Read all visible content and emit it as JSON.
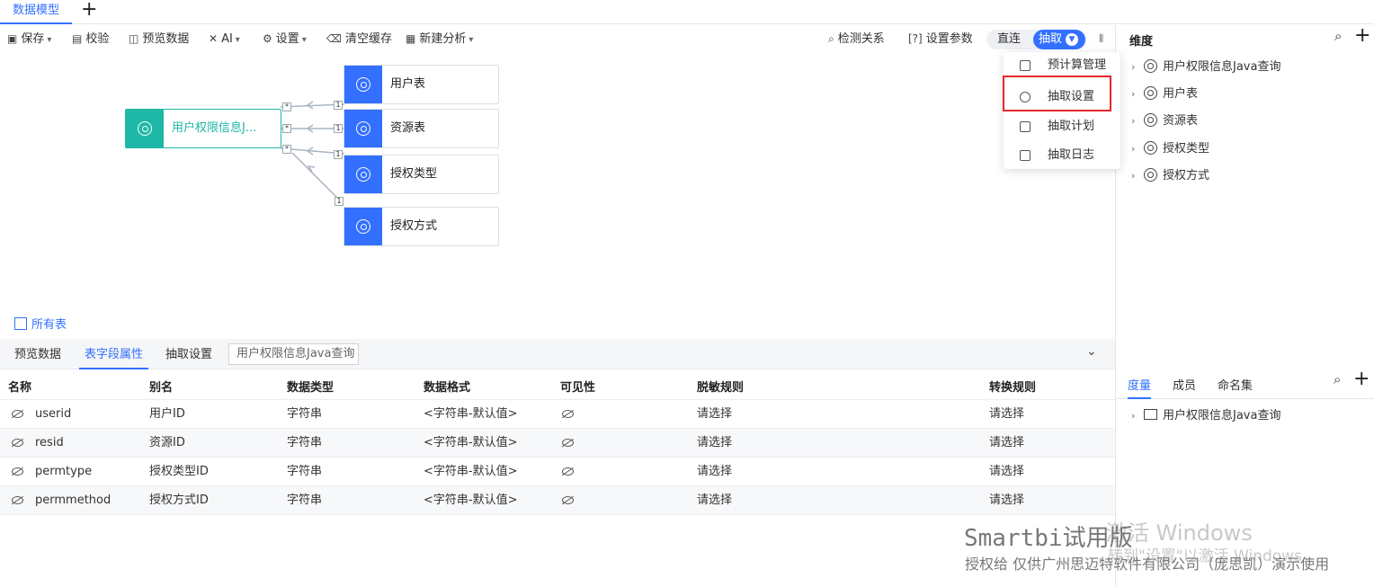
{
  "tabbar": {
    "active_tab": "数据模型",
    "add_icon": "plus-icon"
  },
  "toolbar": {
    "save": "保存",
    "validate": "校验",
    "preview": "预览数据",
    "ai": "AI",
    "settings": "设置",
    "clear_cache": "清空缓存",
    "new_analysis": "新建分析",
    "detect_relation": "检测关系",
    "set_params": "设置参数",
    "mode_direct": "直连",
    "mode_extract": "抽取"
  },
  "dropdown": {
    "items": [
      "预计算管理",
      "抽取设置",
      "抽取计划",
      "抽取日志"
    ],
    "highlighted": "抽取设置"
  },
  "canvas": {
    "main_node": "用户权限信息J...",
    "nodes": [
      "用户表",
      "资源表",
      "授权类型",
      "授权方式"
    ],
    "link_badges": [
      "1",
      "1",
      "1",
      "1"
    ],
    "star_badges": [
      "*",
      "*",
      "*"
    ],
    "all_tables": "所有表"
  },
  "dimension_panel": {
    "title": "维度",
    "items": [
      "用户权限信息Java查询",
      "用户表",
      "资源表",
      "授权类型",
      "授权方式"
    ]
  },
  "bottom_tabs": {
    "preview": "预览数据",
    "fields": "表字段属性",
    "extract": "抽取设置",
    "chip": "用户权限信息Java查询"
  },
  "table": {
    "headers": [
      "名称",
      "别名",
      "数据类型",
      "数据格式",
      "可见性",
      "脱敏规则",
      "转换规则"
    ],
    "rows": [
      {
        "name": "userid",
        "alias": "用户ID",
        "type": "字符串",
        "format": "<字符串-默认值>",
        "mask": "请选择",
        "convert": "请选择"
      },
      {
        "name": "resid",
        "alias": "资源ID",
        "type": "字符串",
        "format": "<字符串-默认值>",
        "mask": "请选择",
        "convert": "请选择"
      },
      {
        "name": "permtype",
        "alias": "授权类型ID",
        "type": "字符串",
        "format": "<字符串-默认值>",
        "mask": "请选择",
        "convert": "请选择"
      },
      {
        "name": "permmethod",
        "alias": "授权方式ID",
        "type": "字符串",
        "format": "<字符串-默认值>",
        "mask": "请选择",
        "convert": "请选择"
      }
    ]
  },
  "measure_panel": {
    "tabs": [
      "度量",
      "成员",
      "命名集"
    ],
    "items": [
      "用户权限信息Java查询"
    ]
  },
  "watermark": {
    "brand": "Smartbi试用版",
    "activate": "激活 Windows",
    "activate_hint": "转到\"设置\"以激活 Windows。",
    "license": "授权给 仅供广州思迈特软件有限公司（庞思凯）演示使用"
  },
  "colors": {
    "accent": "#3370ff",
    "teal": "#1fb7a6",
    "highlight": "#e8262d"
  }
}
